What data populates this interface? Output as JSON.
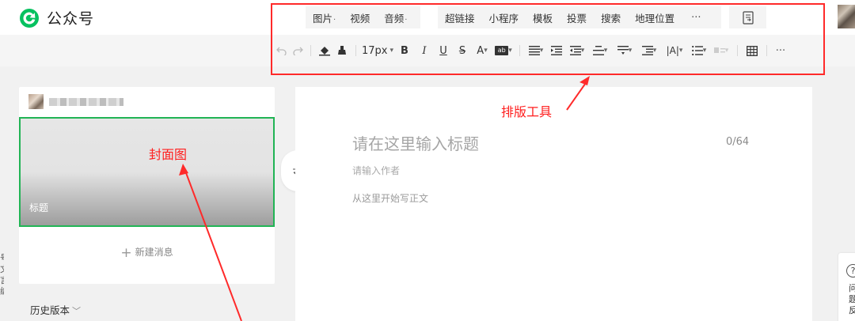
{
  "app": {
    "title": "公众号"
  },
  "insert_menu": {
    "group1": [
      {
        "label": "图片",
        "dropdown": true
      },
      {
        "label": "视频",
        "dropdown": false
      },
      {
        "label": "音频",
        "dropdown": true
      }
    ],
    "group2": [
      "超链接",
      "小程序",
      "模板",
      "投票",
      "搜索",
      "地理位置"
    ],
    "more": "···"
  },
  "format_toolbar": {
    "font_size": "17px",
    "items": [
      "undo-icon",
      "redo-icon",
      "format-brush-icon",
      "clear-format-icon",
      "font-size-select",
      "bold-icon",
      "italic-icon",
      "underline-icon",
      "strikethrough-icon",
      "font-color-icon",
      "background-color-icon",
      "align-icon",
      "indent-icon",
      "paragraph-spacing-icon",
      "line-spacing-icon",
      "letter-spacing-icon",
      "list-icon",
      "table-icon",
      "more-icon"
    ]
  },
  "left_panel": {
    "cover_title": "标题",
    "new_message": "新建消息",
    "history": "历史版本"
  },
  "editor": {
    "title_placeholder": "请在这里输入标题",
    "char_counter": "0/64",
    "author_placeholder": "请输入作者",
    "body_placeholder": "从这里开始写正文"
  },
  "help": {
    "icon": "?",
    "text": "问题反"
  },
  "edge": {
    "text": "号文言编"
  },
  "annotations": {
    "layout_tools": "排版工具",
    "cover_image": "封面图"
  },
  "colors": {
    "annotation_red": "#ff2a2a",
    "brand_green": "#21b455",
    "cover_border": "#21b455"
  }
}
